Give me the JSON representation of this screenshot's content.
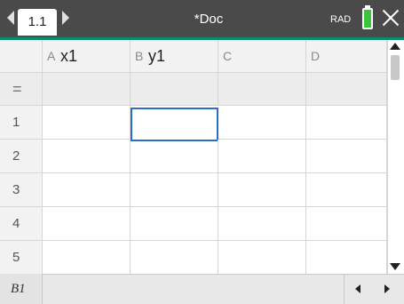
{
  "titlebar": {
    "tab_label": "1.1",
    "doc_title": "*Doc",
    "mode": "RAD",
    "battery_color": "#3cc33c",
    "accent_color": "#0a8a70"
  },
  "spreadsheet": {
    "columns": [
      {
        "letter": "A",
        "name": "x1"
      },
      {
        "letter": "B",
        "name": "y1"
      },
      {
        "letter": "C",
        "name": ""
      },
      {
        "letter": "D",
        "name": ""
      }
    ],
    "formula_row_symbol": "=",
    "rows": [
      "1",
      "2",
      "3",
      "4",
      "5"
    ],
    "selected_cell": "B1"
  },
  "statusbar": {
    "cell_reference": "B1",
    "entry_value": ""
  },
  "icons": {
    "prev_tab": "chevron-left-icon",
    "next_tab": "chevron-right-icon",
    "battery": "battery-icon",
    "close": "close-icon"
  }
}
